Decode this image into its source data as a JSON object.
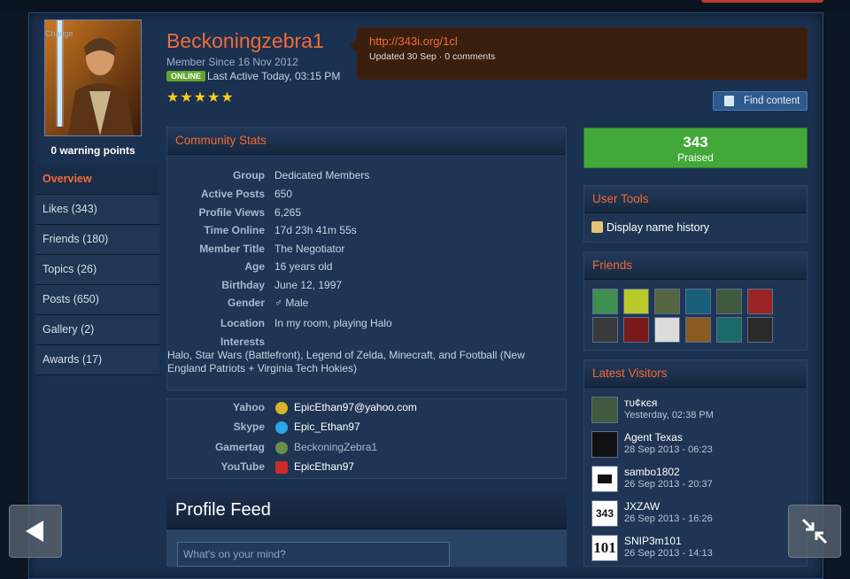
{
  "profile": {
    "change_label": "Change",
    "warning_points": "0 warning points",
    "username": "Beckoningzebra1",
    "member_since": "Member Since 16 Nov 2012",
    "online_badge": "ONLINE",
    "last_active": "Last Active Today, 03:15 PM",
    "rating_stars": "★★★★★"
  },
  "status": {
    "link": "http://343i.org/1cl",
    "meta": "Updated 30 Sep · 0 comments"
  },
  "find_content": "Find content",
  "nav": {
    "items": [
      {
        "label": "Overview"
      },
      {
        "label": "Likes (343)"
      },
      {
        "label": "Friends (180)"
      },
      {
        "label": "Topics (26)"
      },
      {
        "label": "Posts (650)"
      },
      {
        "label": "Gallery (2)"
      },
      {
        "label": "Awards (17)"
      }
    ]
  },
  "community_stats": {
    "title": "Community Stats",
    "rows": [
      {
        "k": "Group",
        "v": "Dedicated Members"
      },
      {
        "k": "Active Posts",
        "v": "650"
      },
      {
        "k": "Profile Views",
        "v": "6,265"
      },
      {
        "k": "Time Online",
        "v": "17d 23h 41m 55s"
      },
      {
        "k": "Member Title",
        "v": "The Negotiator"
      },
      {
        "k": "Age",
        "v": "16 years old"
      },
      {
        "k": "Birthday",
        "v": "June 12, 1997"
      },
      {
        "k": "Gender",
        "v": "♂ Male"
      },
      {
        "k": "Location",
        "v": "In my room, playing Halo"
      },
      {
        "k": "Interests",
        "v": ""
      }
    ],
    "interests_text": "Halo, Star Wars (Battlefront), Legend of Zelda, Minecraft, and Football (New England Patriots + Virginia Tech Hokies)"
  },
  "contacts": [
    {
      "k": "Yahoo",
      "v": "EpicEthan97@yahoo.com"
    },
    {
      "k": "Skype",
      "v": "Epic_Ethan97"
    },
    {
      "k": "Gamertag",
      "v": "BeckoningZebra1"
    },
    {
      "k": "YouTube",
      "v": "EpicEthan97"
    }
  ],
  "feed": {
    "title": "Profile Feed",
    "placeholder": "What's on your mind?"
  },
  "praised": {
    "count": "343",
    "label": "Praised"
  },
  "user_tools": {
    "title": "User Tools",
    "item": "Display name history"
  },
  "friends": {
    "title": "Friends"
  },
  "latest_visitors": {
    "title": "Latest Visitors",
    "items": [
      {
        "name": "ᴛᴜ¢κєя",
        "time": "Yesterday, 02:38 PM"
      },
      {
        "name": "Agent Texas",
        "time": "28 Sep 2013 - 06:23"
      },
      {
        "name": "sambo1802",
        "time": "26 Sep 2013 - 20:37"
      },
      {
        "name": "JXZAW",
        "time": "26 Sep 2013 - 16:26"
      },
      {
        "name": "SNIP3m101",
        "time": "26 Sep 2013 - 14:13"
      }
    ],
    "avatar_text": [
      "",
      "",
      "",
      "343",
      "101"
    ]
  },
  "colors": {
    "accent": "#f26a34",
    "praise": "#42a83a",
    "online": "#5fa62b"
  }
}
